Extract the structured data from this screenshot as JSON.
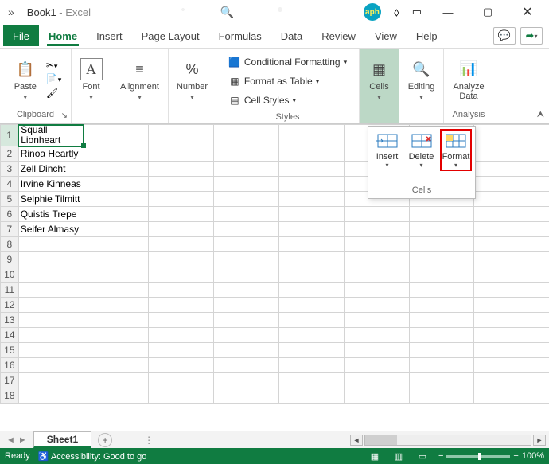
{
  "window": {
    "title_doc": "Book1",
    "title_app": "Excel",
    "sep": "  -  "
  },
  "tabs": {
    "file": "File",
    "items": [
      "Home",
      "Insert",
      "Page Layout",
      "Formulas",
      "Data",
      "Review",
      "View",
      "Help"
    ],
    "active_index": 0
  },
  "ribbon": {
    "clipboard": {
      "label": "Clipboard",
      "paste": "Paste"
    },
    "font": {
      "label": "Font"
    },
    "alignment": {
      "label": "Alignment"
    },
    "number": {
      "label": "Number"
    },
    "styles": {
      "label": "Styles",
      "conditional": "Conditional Formatting",
      "table": "Format as Table",
      "cell": "Cell Styles"
    },
    "cells": {
      "label": "Cells"
    },
    "editing": {
      "label": "Editing"
    },
    "analyze": {
      "label": "Analyze Data",
      "group": "Analysis"
    }
  },
  "cells_menu": {
    "insert": "Insert",
    "delete": "Delete",
    "format": "Format",
    "group": "Cells"
  },
  "grid": {
    "rows": [
      "Squall Lionheart",
      "Rinoa Heartly",
      "Zell Dincht",
      "Irvine Kinneas",
      "Selphie Tilmitt",
      "Quistis Trepe",
      "Seifer Almasy"
    ],
    "row_numbers": [
      "1",
      "2",
      "3",
      "4",
      "5",
      "6",
      "7",
      "8",
      "9",
      "10",
      "11",
      "12",
      "13",
      "14",
      "15",
      "16",
      "17",
      "18"
    ],
    "sel_cell_line1": "Squall",
    "sel_cell_line2": "Lionheart"
  },
  "sheet_tabs": {
    "active": "Sheet1"
  },
  "status": {
    "ready": "Ready",
    "accessibility": "Accessibility: Good to go",
    "zoom": "100%"
  },
  "badge": "aph"
}
